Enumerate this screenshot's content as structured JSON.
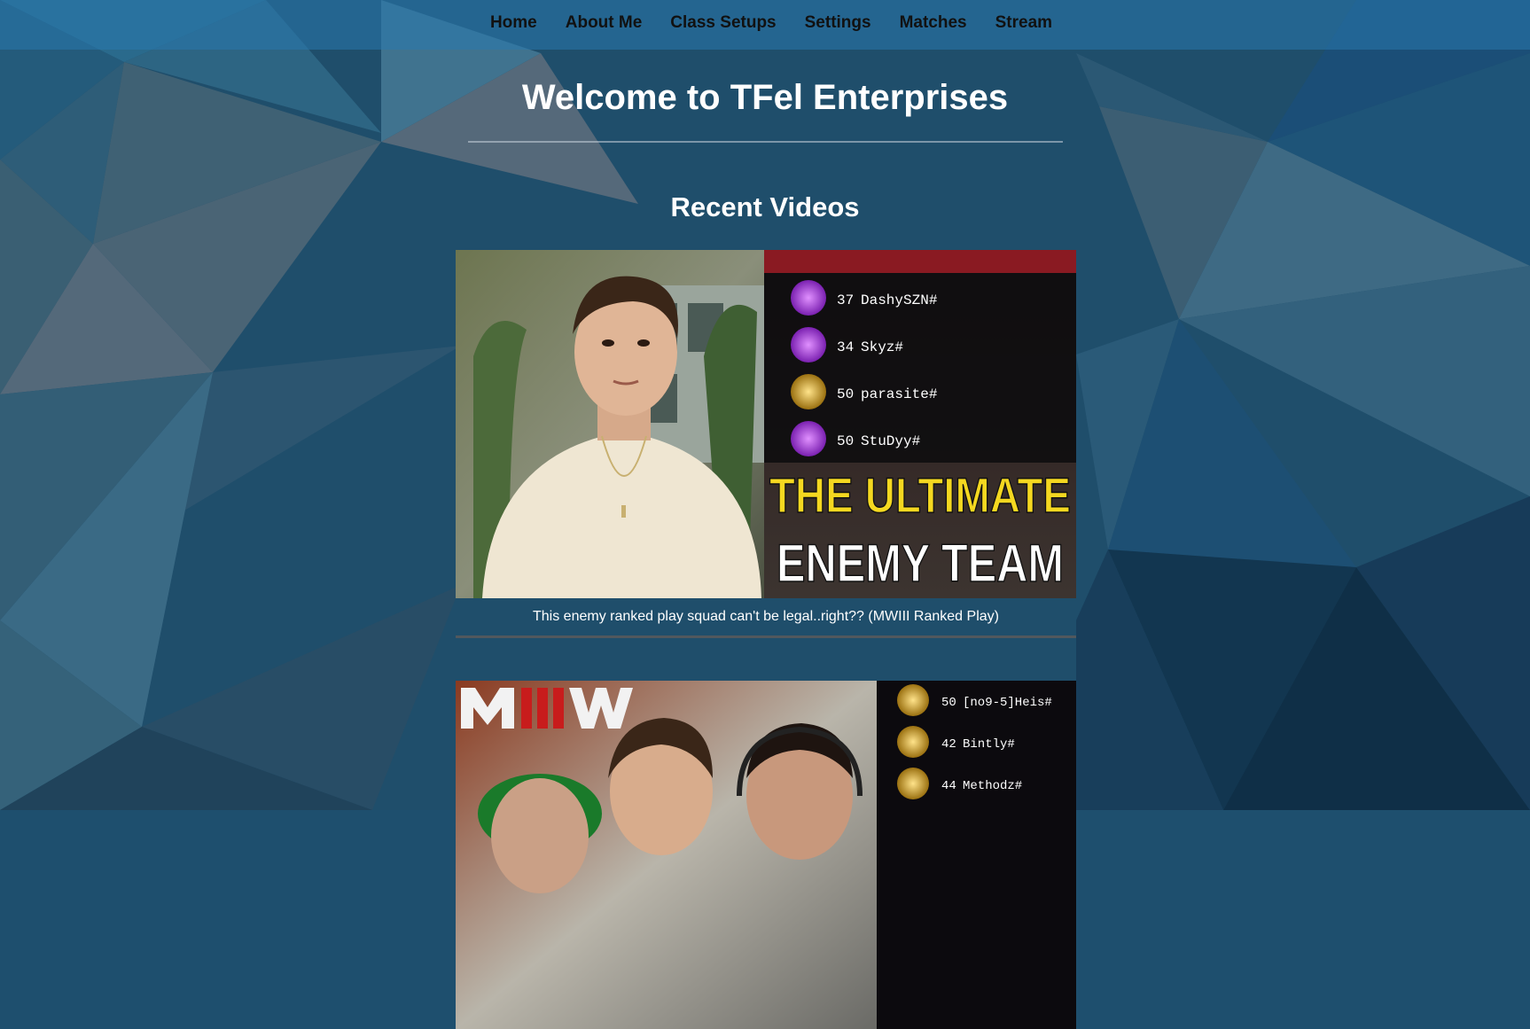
{
  "nav": {
    "items": [
      {
        "label": "Home"
      },
      {
        "label": "About Me"
      },
      {
        "label": "Class Setups"
      },
      {
        "label": "Settings"
      },
      {
        "label": "Matches"
      },
      {
        "label": "Stream"
      }
    ]
  },
  "page": {
    "title": "Welcome to TFel Enterprises",
    "section_title": "Recent Videos"
  },
  "videos": [
    {
      "caption": "This enemy ranked play squad can't be legal..right?? (MWIII Ranked Play)",
      "thumbnail": {
        "headline_line1": "THE ULTIMATE",
        "headline_line2": "ENEMY TEAM",
        "scoreboard": [
          {
            "score": "37",
            "name": "DashySZN#"
          },
          {
            "score": "34",
            "name": "Skyz#"
          },
          {
            "score": "50",
            "name": "parasite#"
          },
          {
            "score": "50",
            "name": "StuDyy#"
          }
        ]
      }
    },
    {
      "caption": "",
      "thumbnail": {
        "logo_text": "MIIIW",
        "scoreboard": [
          {
            "score": "50",
            "name": "[no9-5]Heis#"
          },
          {
            "score": "42",
            "name": "Bintly#"
          },
          {
            "score": "44",
            "name": "Methodz#"
          }
        ]
      }
    }
  ],
  "colors": {
    "nav_bg": "#2878af",
    "page_bg": "#1e4f6e",
    "headline_yellow": "#f5d820",
    "headline_white": "#ffffff",
    "rank_purple": "#a040d0",
    "rank_gold": "#c9a030"
  },
  "icons": [
    "rank-badge-icon",
    "gold-skull-badge-icon",
    "mw3-logo"
  ]
}
